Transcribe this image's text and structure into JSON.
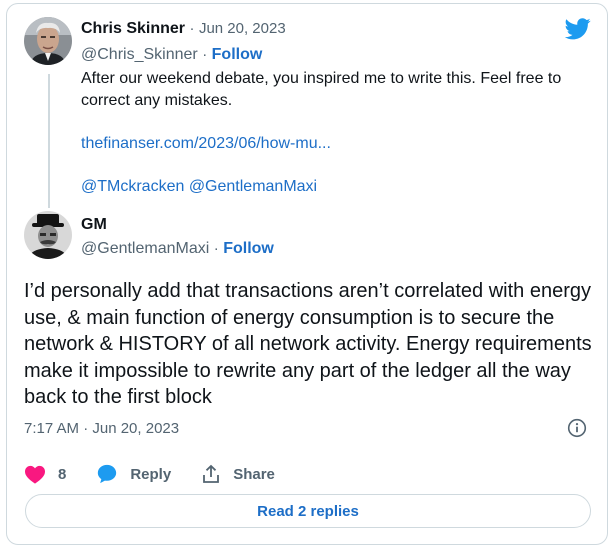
{
  "quoted_tweet": {
    "author_name": "Chris Skinner",
    "separator": "·",
    "date": "Jun 20, 2023",
    "handle": "@Chris_Skinner",
    "follow_label": "Follow",
    "text_line": "After our weekend debate, you inspired me to write this. Feel free to correct any mistakes.",
    "link": "thefinanser.com/2023/06/how-mu...",
    "mentions": "@TMckracken @GentlemanMaxi"
  },
  "tweet": {
    "author_name": "GM",
    "handle": "@GentlemanMaxi",
    "separator": "·",
    "follow_label": "Follow",
    "text": "I’d personally add that transactions aren’t correlated with energy use, & main function of energy consumption is to secure the network & HISTORY of all network activity. Energy requirements make it impossible to rewrite any part of the ledger all the way back to the first block",
    "timestamp": "7:17 AM · Jun 20, 2023"
  },
  "actions": {
    "like_count": "8",
    "reply_label": "Reply",
    "share_label": "Share"
  },
  "read_replies_label": "Read 2 replies",
  "icons": {
    "brand": "twitter-bird-icon",
    "info": "info-icon",
    "like": "heart-icon",
    "reply": "speech-bubble-icon",
    "share": "share-upload-icon"
  },
  "colors": {
    "link": "#1d6ec7",
    "twitter_blue": "#1d9bf0",
    "heart": "#f91880",
    "muted": "#536471",
    "border": "#cfd9de"
  }
}
